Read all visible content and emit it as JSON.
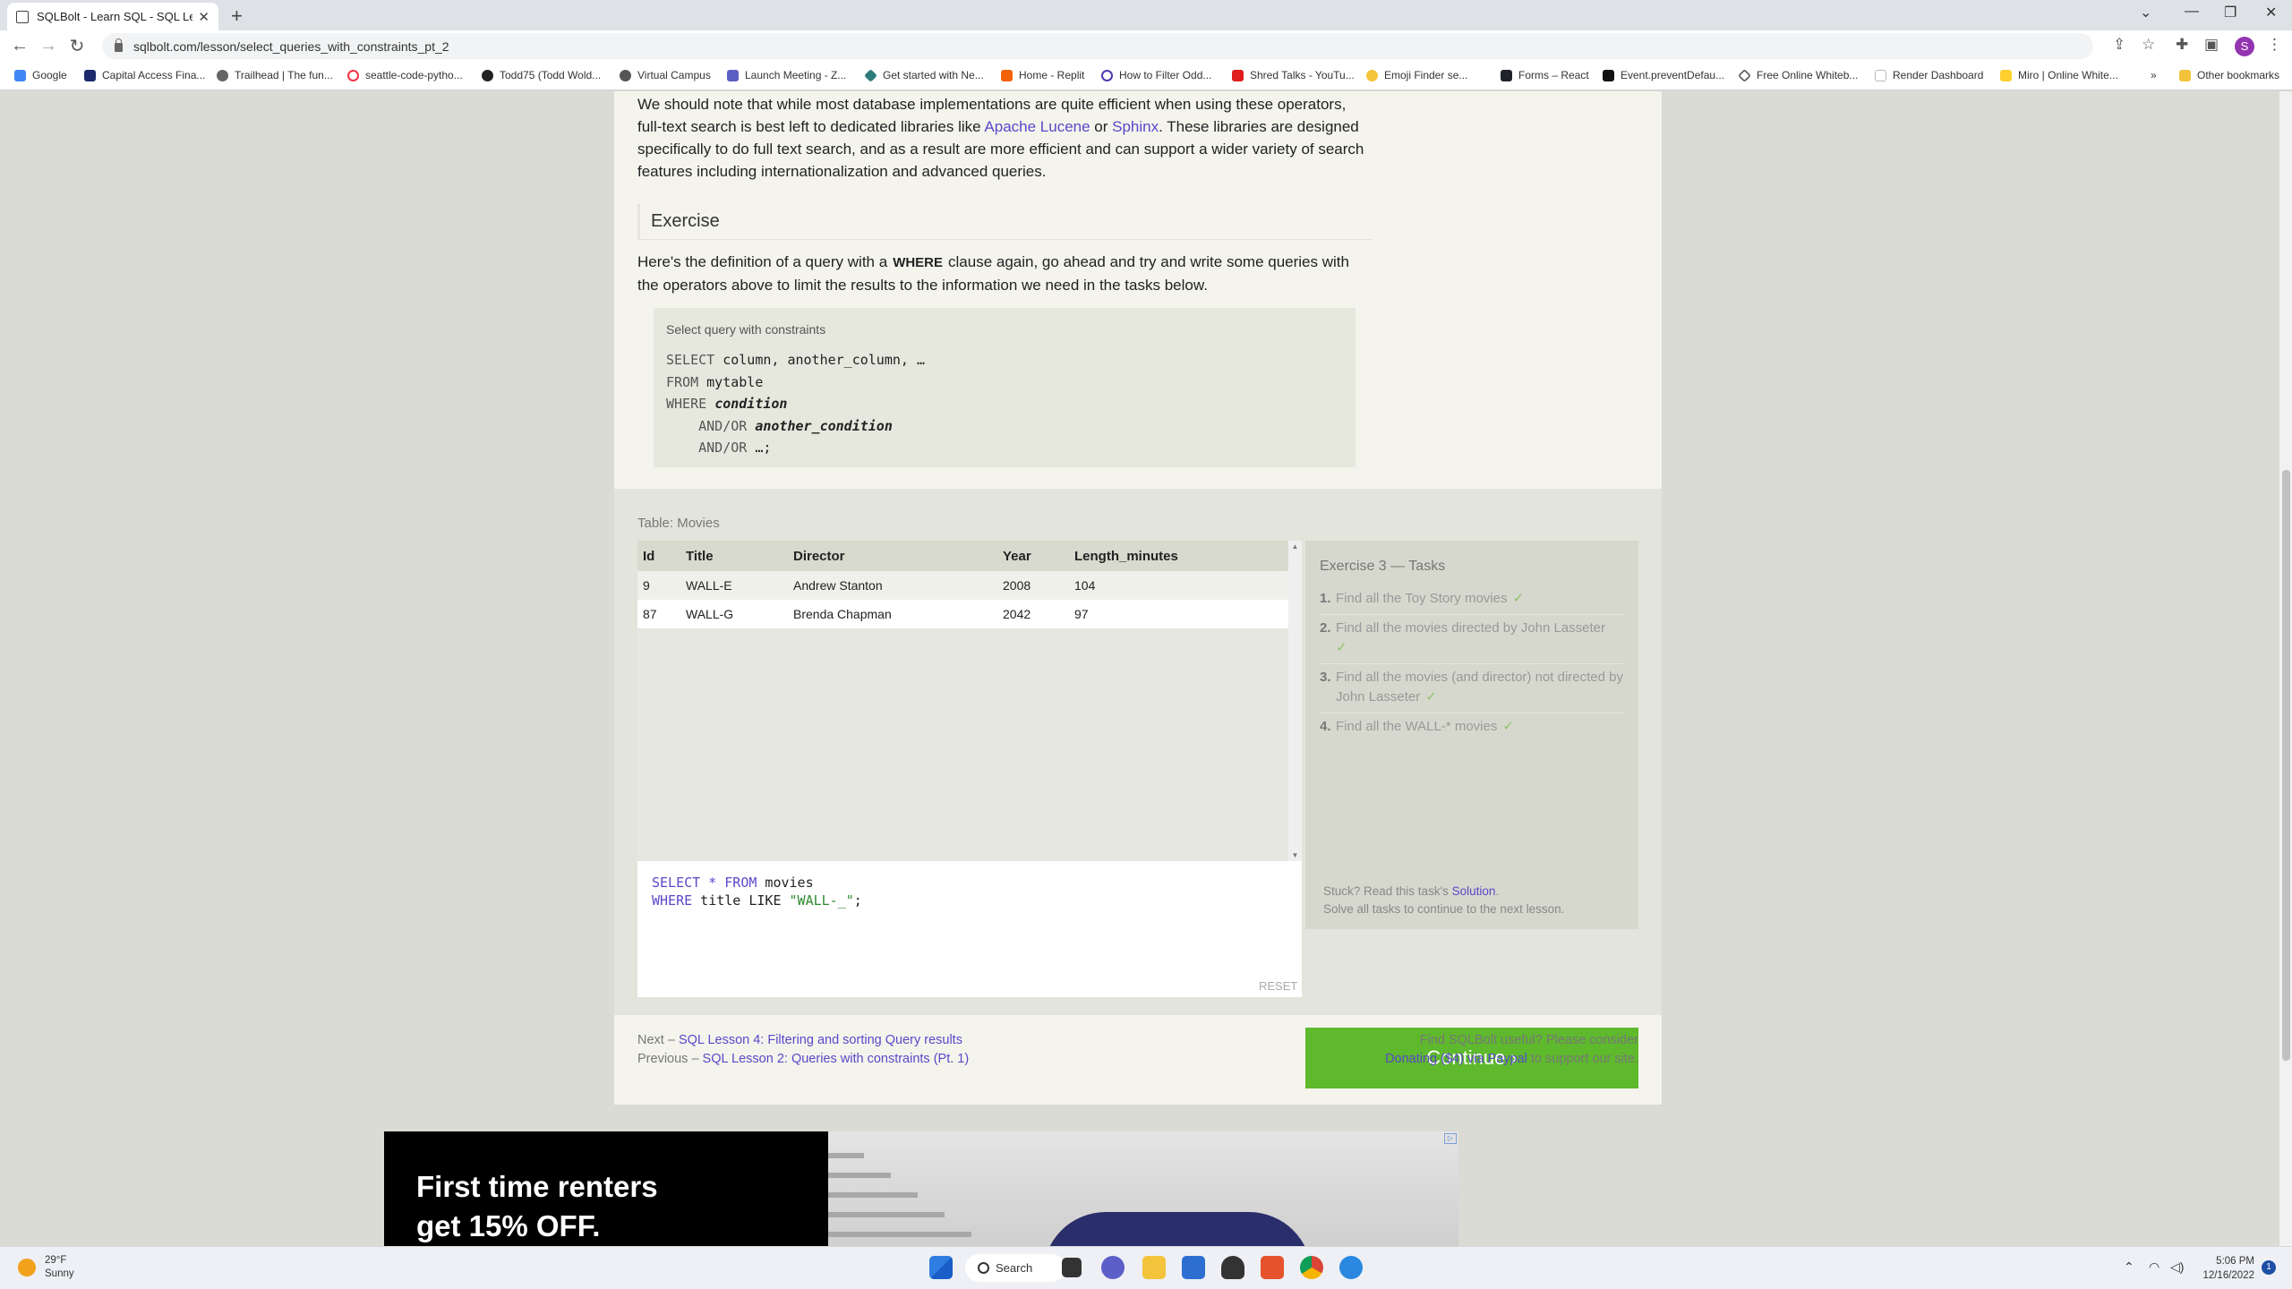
{
  "browser": {
    "tab_title": "SQLBolt - Learn SQL - SQL Lesso",
    "url": "sqlbolt.com/lesson/select_queries_with_constraints_pt_2",
    "profile_initial": "S",
    "bookmarks": [
      "Google",
      "Capital Access Fina...",
      "Trailhead | The fun...",
      "seattle-code-pytho...",
      "Todd75 (Todd Wold...",
      "Virtual Campus",
      "Launch Meeting - Z...",
      "Get started with Ne...",
      "Home - Replit",
      "How to Filter Odd...",
      "Shred Talks - YouTu...",
      "Emoji Finder se...",
      "Forms – React",
      "Event.preventDefau...",
      "Free Online Whiteb...",
      "Render Dashboard",
      "Miro | Online White..."
    ],
    "other_bookmarks": "Other bookmarks",
    "more": "»"
  },
  "lesson": {
    "intro_pre": "We should note that while most database implementations are quite efficient when using these operators,",
    "intro_l2_pre": "full-text search is best left to dedicated libraries like ",
    "link_lucene": "Apache Lucene",
    "intro_or": " or ",
    "link_sphinx": "Sphinx",
    "intro_l2_post": ". These libraries are designed",
    "intro_l3": "specifically to do full text search, and as a result are more efficient and can support a wider variety of search",
    "intro_l4": "features including internationalization and advanced queries.",
    "exercise_heading": "Exercise",
    "def_pre": "Here's the definition of a query with a",
    "def_kw": "WHERE",
    "def_post": "clause again, go ahead and try and write some queries with",
    "def_l2": "the operators above to limit the results to the information we need in the tasks below.",
    "code_caption": "Select query with constraints",
    "code": {
      "l1_kw": "SELECT",
      "l1_rest": " column, another_column, …",
      "l2_kw": "FROM",
      "l2_rest": " mytable",
      "l3_kw": "WHERE",
      "l3_it": "condition",
      "l4_kw": "    AND/OR",
      "l4_it": "another_condition",
      "l5_kw": "    AND/OR",
      "l5_rest": " …;"
    }
  },
  "exercise": {
    "table_label": "Table: Movies",
    "columns": [
      "Id",
      "Title",
      "Director",
      "Year",
      "Length_minutes"
    ],
    "rows": [
      [
        "9",
        "WALL-E",
        "Andrew Stanton",
        "2008",
        "104"
      ],
      [
        "87",
        "WALL-G",
        "Brenda Chapman",
        "2042",
        "97"
      ]
    ],
    "editor": {
      "l1_kw1": "SELECT",
      "l1_star": " * ",
      "l1_kw2": "FROM",
      "l1_rest": " movies",
      "l2_kw": "WHERE",
      "l2_rest": " title LIKE ",
      "l2_str": "\"WALL-_\"",
      "l2_end": ";"
    },
    "reset": "RESET",
    "tasks_title": "Exercise 3 — Tasks",
    "tasks": [
      {
        "n": "1.",
        "text": "Find all the Toy Story movies",
        "check": "✓"
      },
      {
        "n": "2.",
        "text": "Find all the movies directed by John Lasseter",
        "check": "✓"
      },
      {
        "n": "3.",
        "text": "Find all the movies (and director) not directed by John Lasseter",
        "check": "✓"
      },
      {
        "n": "4.",
        "text": "Find all the WALL-* movies",
        "check": "✓"
      }
    ],
    "stuck_pre": "Stuck? Read this task's ",
    "stuck_link": "Solution",
    "stuck_post": ".",
    "solve_all": "Solve all tasks to continue to the next lesson.",
    "continue": "Continue ›"
  },
  "footer": {
    "next_pre": "Next – ",
    "next_link": "SQL Lesson 4: Filtering and sorting Query results",
    "prev_pre": "Previous – ",
    "prev_link": "SQL Lesson 2: Queries with constraints (Pt. 1)",
    "useful": "Find SQLBolt useful? Please consider",
    "donate_link": "Donating ($4) via Paypal",
    "donate_post": " to support our site."
  },
  "ad": {
    "line1": "First time renters",
    "line2": "get 15% OFF."
  },
  "taskbar": {
    "temp": "29°F",
    "condition": "Sunny",
    "search": "Search",
    "time": "5:06 PM",
    "date": "12/16/2022",
    "notifications": "1"
  }
}
